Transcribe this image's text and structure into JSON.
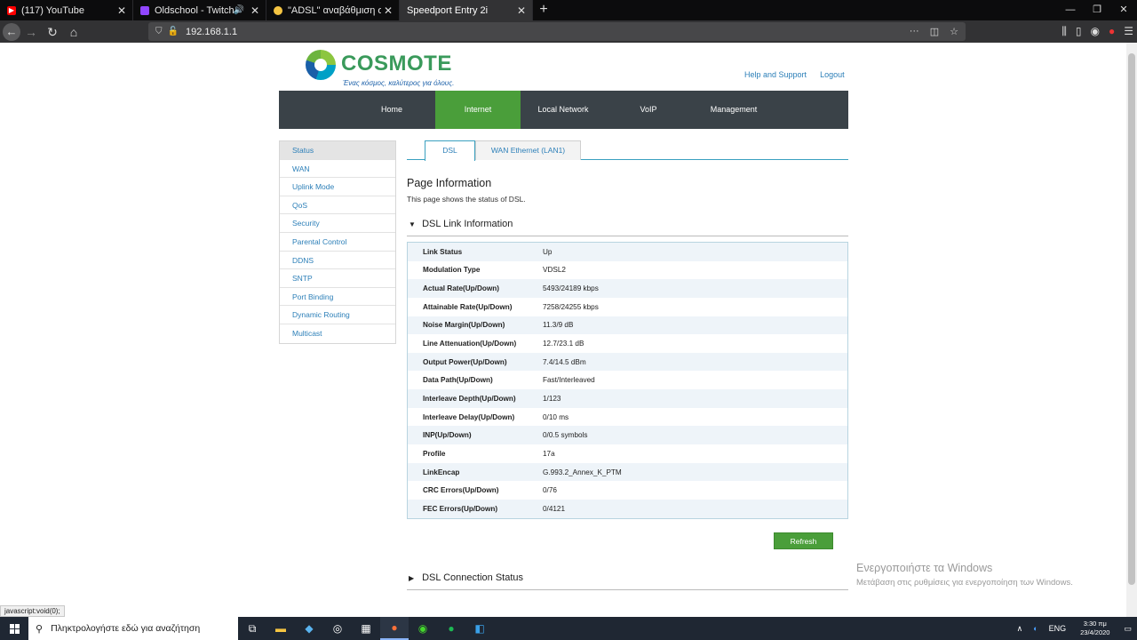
{
  "browser": {
    "tabs": [
      {
        "title": "(117) YouTube",
        "favicon": "youtube-icon",
        "color": "#ff0000"
      },
      {
        "title": "Oldschool - Twitch",
        "favicon": "twitch-icon",
        "color": "#9146ff"
      },
      {
        "title": "\"ADSL\" αναβάθμιση σε VDSL -",
        "favicon": "emoji-icon",
        "color": "#f5c542"
      },
      {
        "title": "Speedport Entry 2i",
        "favicon": "",
        "color": ""
      }
    ],
    "url": "192.168.1.1",
    "status_url": "javascript:void(0);"
  },
  "site": {
    "brand": "COSMOTE",
    "tagline": "Ένας κόσμος, καλύτερος για όλους.",
    "links": {
      "help": "Help and Support",
      "logout": "Logout"
    },
    "nav": [
      "Home",
      "Internet",
      "Local Network",
      "VoIP",
      "Management"
    ],
    "nav_active": "Internet",
    "sidebar": [
      "Status",
      "WAN",
      "Uplink Mode",
      "QoS",
      "Security",
      "Parental Control",
      "DDNS",
      "SNTP",
      "Port Binding",
      "Dynamic Routing",
      "Multicast"
    ],
    "sidebar_active": "Status",
    "subtabs": [
      "DSL",
      "WAN Ethernet (LAN1)"
    ],
    "subtab_active": "DSL"
  },
  "content": {
    "title": "Page Information",
    "desc": "This page shows the status of DSL.",
    "section1": "DSL Link Information",
    "rows": [
      {
        "k": "Link Status",
        "v": "Up"
      },
      {
        "k": "Modulation Type",
        "v": "VDSL2"
      },
      {
        "k": "Actual Rate(Up/Down)",
        "v": "5493/24189 kbps"
      },
      {
        "k": "Attainable Rate(Up/Down)",
        "v": "7258/24255 kbps"
      },
      {
        "k": "Noise Margin(Up/Down)",
        "v": "11.3/9 dB"
      },
      {
        "k": "Line Attenuation(Up/Down)",
        "v": "12.7/23.1 dB"
      },
      {
        "k": "Output Power(Up/Down)",
        "v": "7.4/14.5 dBm"
      },
      {
        "k": "Data Path(Up/Down)",
        "v": "Fast/Interleaved"
      },
      {
        "k": "Interleave Depth(Up/Down)",
        "v": "1/123"
      },
      {
        "k": "Interleave Delay(Up/Down)",
        "v": "0/10 ms"
      },
      {
        "k": "INP(Up/Down)",
        "v": "0/0.5 symbols"
      },
      {
        "k": "Profile",
        "v": "17a"
      },
      {
        "k": "LinkEncap",
        "v": "G.993.2_Annex_K_PTM"
      },
      {
        "k": "CRC Errors(Up/Down)",
        "v": "0/76"
      },
      {
        "k": "FEC Errors(Up/Down)",
        "v": "0/4121"
      }
    ],
    "refresh": "Refresh",
    "section2": "DSL Connection Status"
  },
  "watermark": {
    "line1": "Ενεργοποιήστε τα Windows",
    "line2": "Μετάβαση στις ρυθμίσεις για ενεργοποίηση των Windows."
  },
  "taskbar": {
    "search_placeholder": "Πληκτρολογήστε εδώ για αναζήτηση",
    "lang": "ENG",
    "time": "3:30 πμ",
    "date": "23/4/2020"
  }
}
